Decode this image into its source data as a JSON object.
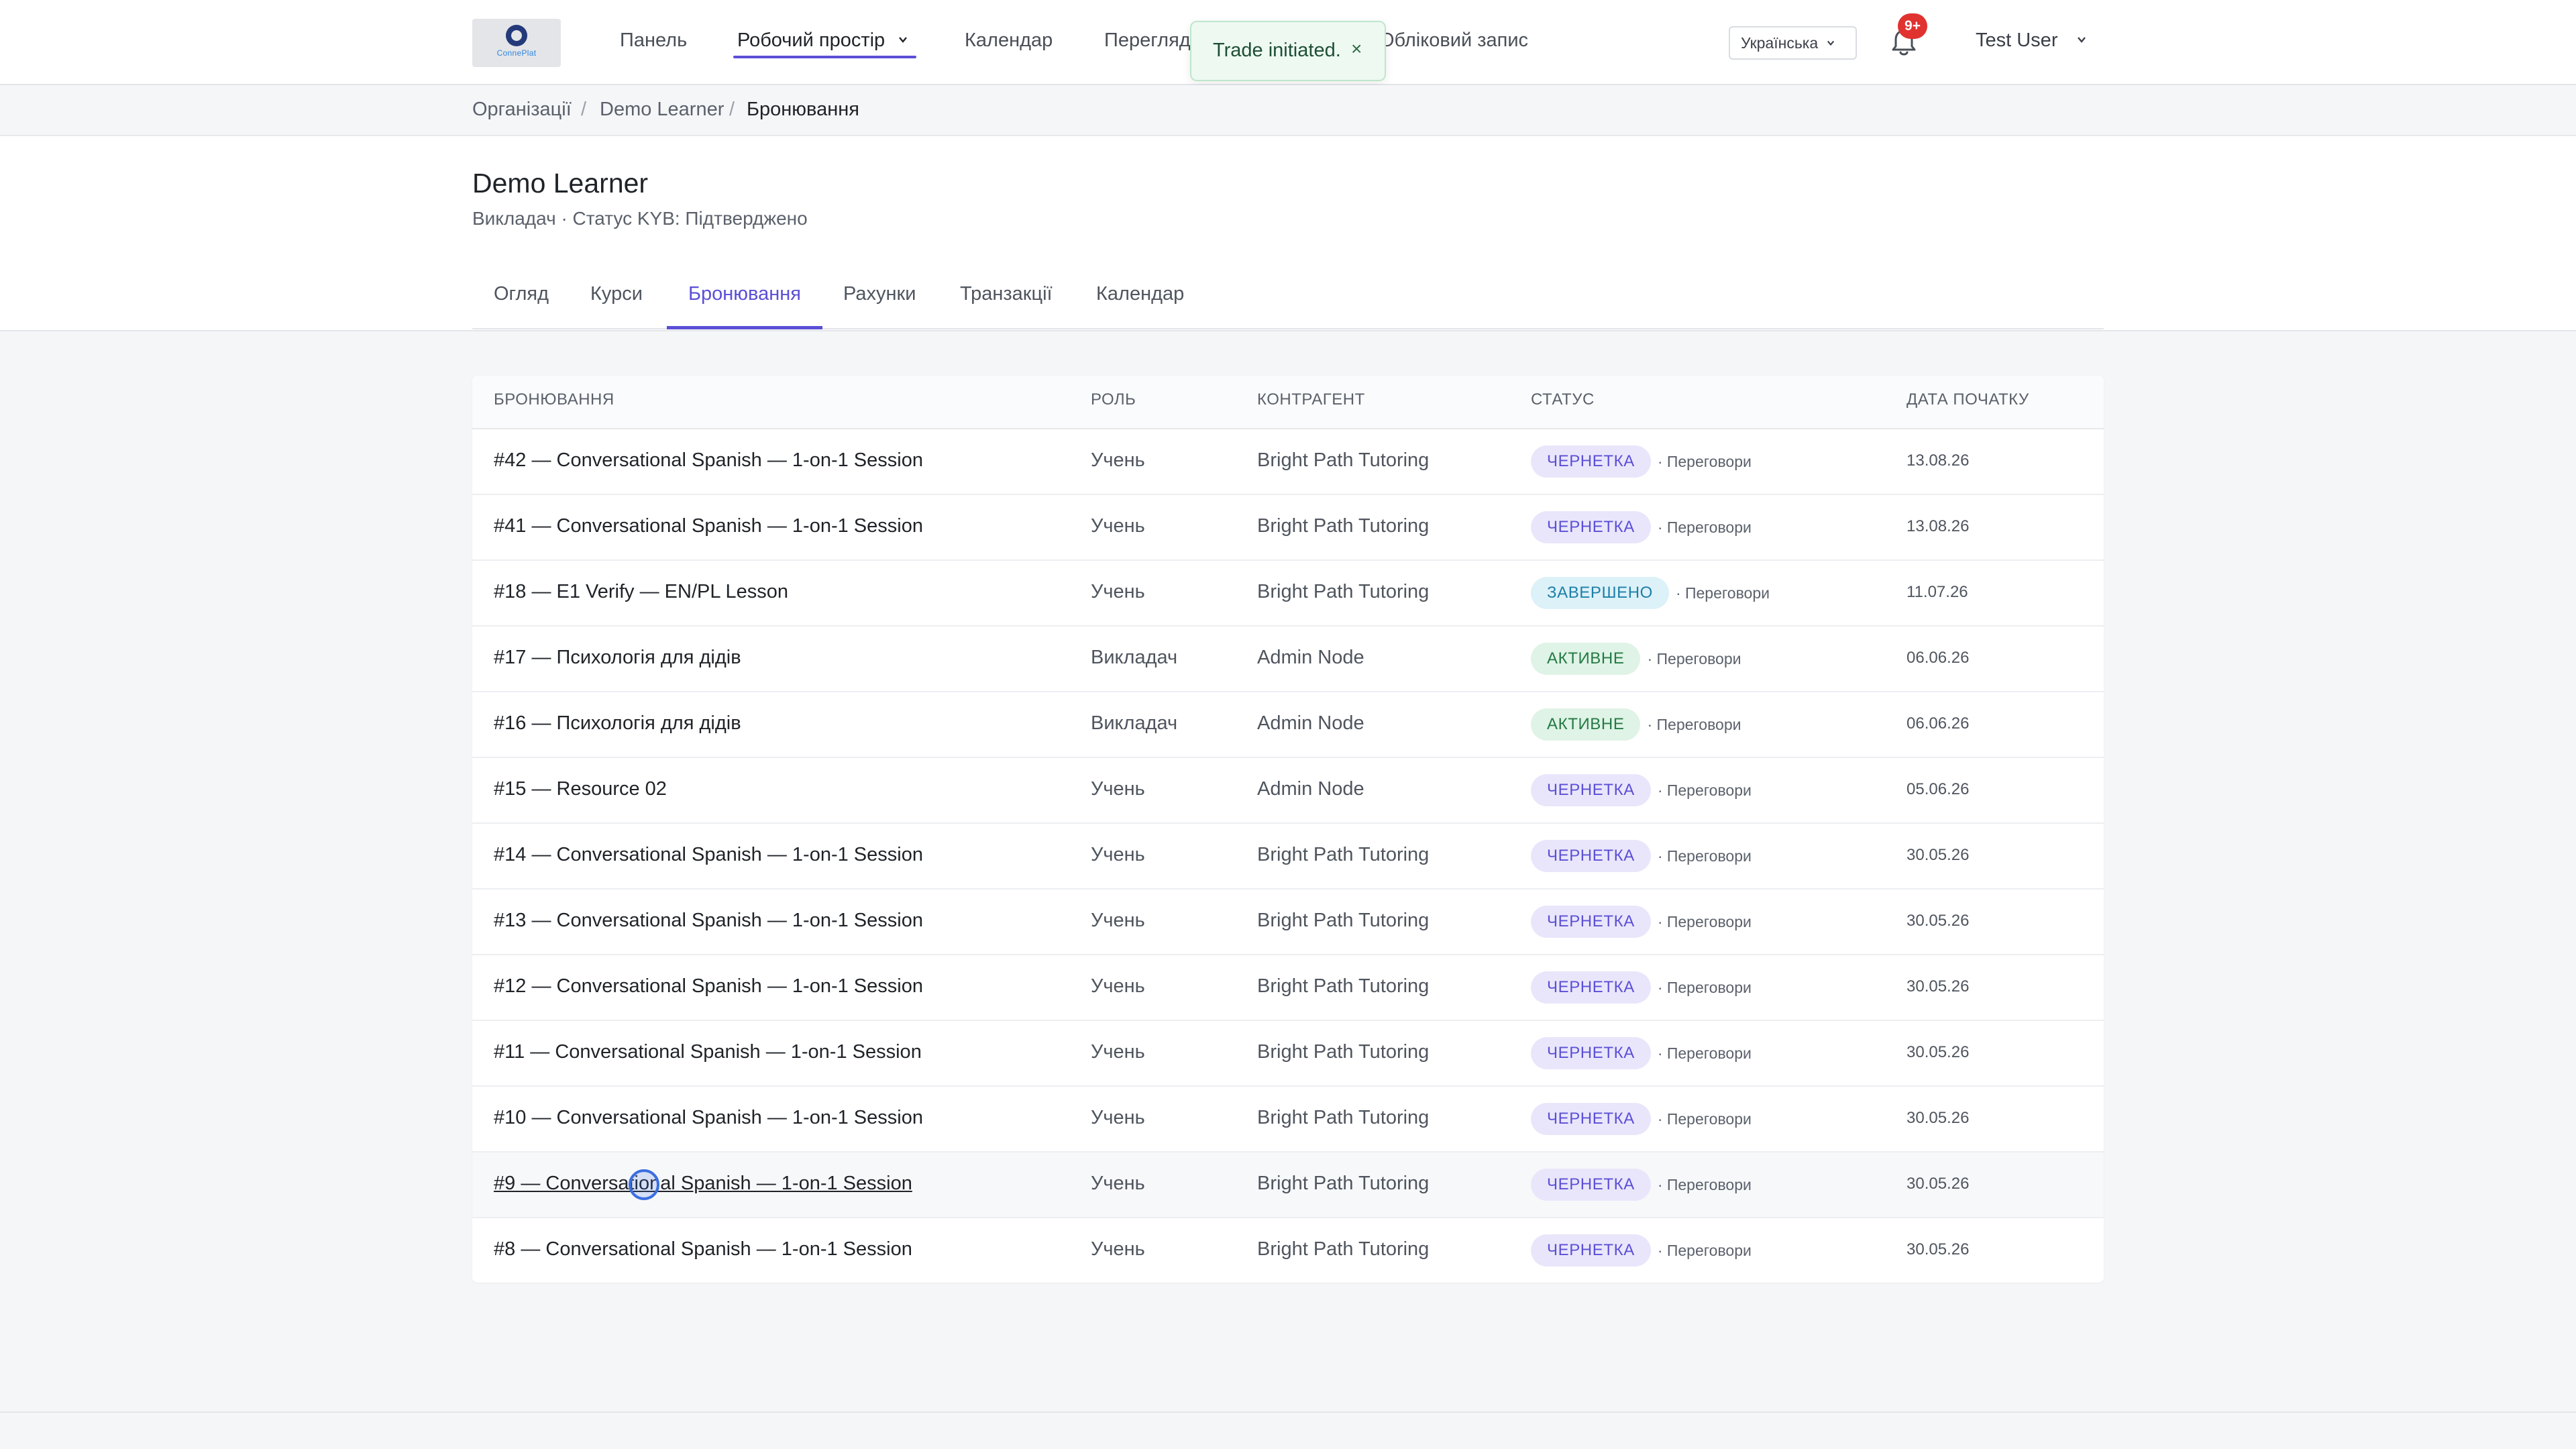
{
  "app": {
    "logo_text_a": "Conne",
    "logo_text_b": "Plat"
  },
  "nav": {
    "items": [
      {
        "label": "Панель"
      },
      {
        "label": "Робочий простір"
      },
      {
        "label": "Календар"
      },
      {
        "label": "Перегляд"
      },
      {
        "label": "Обліковий запис"
      }
    ],
    "language": "Українська",
    "notifications_badge": "9+",
    "user_name": "Test User"
  },
  "toast": {
    "message": "Trade initiated.",
    "close_glyph": "×"
  },
  "breadcrumb": {
    "items": [
      "Організації",
      "Demo Learner",
      "Бронювання"
    ],
    "separator": "/"
  },
  "header": {
    "title": "Demo Learner",
    "subtitle": "Викладач · Статус KYB: Підтверджено"
  },
  "tabs": [
    {
      "label": "Огляд"
    },
    {
      "label": "Курси"
    },
    {
      "label": "Бронювання"
    },
    {
      "label": "Рахунки"
    },
    {
      "label": "Транзакції"
    },
    {
      "label": "Календар"
    }
  ],
  "table": {
    "columns": [
      "Бронювання",
      "Роль",
      "Контрагент",
      "Статус",
      "Дата початку"
    ],
    "rows": [
      {
        "name": "#42 — Conversational Spanish — 1-on-1 Session",
        "role": "Учень",
        "counterparty": "Bright Path Tutoring",
        "status": "ЧЕРНЕТКА",
        "status_kind": "draft",
        "stage": "· Переговори",
        "date": "13.08.26"
      },
      {
        "name": "#41 — Conversational Spanish — 1-on-1 Session",
        "role": "Учень",
        "counterparty": "Bright Path Tutoring",
        "status": "ЧЕРНЕТКА",
        "status_kind": "draft",
        "stage": "· Переговори",
        "date": "13.08.26"
      },
      {
        "name": "#18 — E1 Verify — EN/PL Lesson",
        "role": "Учень",
        "counterparty": "Bright Path Tutoring",
        "status": "ЗАВЕРШЕНО",
        "status_kind": "done",
        "stage": "· Переговори",
        "date": "11.07.26"
      },
      {
        "name": "#17 — Психологія для дідів",
        "role": "Викладач",
        "counterparty": "Admin Node",
        "status": "АКТИВНЕ",
        "status_kind": "active",
        "stage": "· Переговори",
        "date": "06.06.26"
      },
      {
        "name": "#16 — Психологія для дідів",
        "role": "Викладач",
        "counterparty": "Admin Node",
        "status": "АКТИВНЕ",
        "status_kind": "active",
        "stage": "· Переговори",
        "date": "06.06.26"
      },
      {
        "name": "#15 — Resource 02",
        "role": "Учень",
        "counterparty": "Admin Node",
        "status": "ЧЕРНЕТКА",
        "status_kind": "draft",
        "stage": "· Переговори",
        "date": "05.06.26"
      },
      {
        "name": "#14 — Conversational Spanish — 1-on-1 Session",
        "role": "Учень",
        "counterparty": "Bright Path Tutoring",
        "status": "ЧЕРНЕТКА",
        "status_kind": "draft",
        "stage": "· Переговори",
        "date": "30.05.26"
      },
      {
        "name": "#13 — Conversational Spanish — 1-on-1 Session",
        "role": "Учень",
        "counterparty": "Bright Path Tutoring",
        "status": "ЧЕРНЕТКА",
        "status_kind": "draft",
        "stage": "· Переговори",
        "date": "30.05.26"
      },
      {
        "name": "#12 — Conversational Spanish — 1-on-1 Session",
        "role": "Учень",
        "counterparty": "Bright Path Tutoring",
        "status": "ЧЕРНЕТКА",
        "status_kind": "draft",
        "stage": "· Переговори",
        "date": "30.05.26"
      },
      {
        "name": "#11 — Conversational Spanish — 1-on-1 Session",
        "role": "Учень",
        "counterparty": "Bright Path Tutoring",
        "status": "ЧЕРНЕТКА",
        "status_kind": "draft",
        "stage": "· Переговори",
        "date": "30.05.26"
      },
      {
        "name": "#10 — Conversational Spanish — 1-on-1 Session",
        "role": "Учень",
        "counterparty": "Bright Path Tutoring",
        "status": "ЧЕРНЕТКА",
        "status_kind": "draft",
        "stage": "· Переговори",
        "date": "30.05.26"
      },
      {
        "name": "#9 — Conversational Spanish — 1-on-1 Session",
        "role": "Учень",
        "counterparty": "Bright Path Tutoring",
        "status": "ЧЕРНЕТКА",
        "status_kind": "draft",
        "stage": "· Переговори",
        "date": "30.05.26"
      },
      {
        "name": "#8 — Conversational Spanish — 1-on-1 Session",
        "role": "Учень",
        "counterparty": "Bright Path Tutoring",
        "status": "ЧЕРНЕТКА",
        "status_kind": "draft",
        "stage": "· Переговори",
        "date": "30.05.26"
      }
    ]
  },
  "colors": {
    "accent": "#5b4fd6",
    "badge": "#e0322f",
    "toast_bg": "#eef9f2"
  }
}
